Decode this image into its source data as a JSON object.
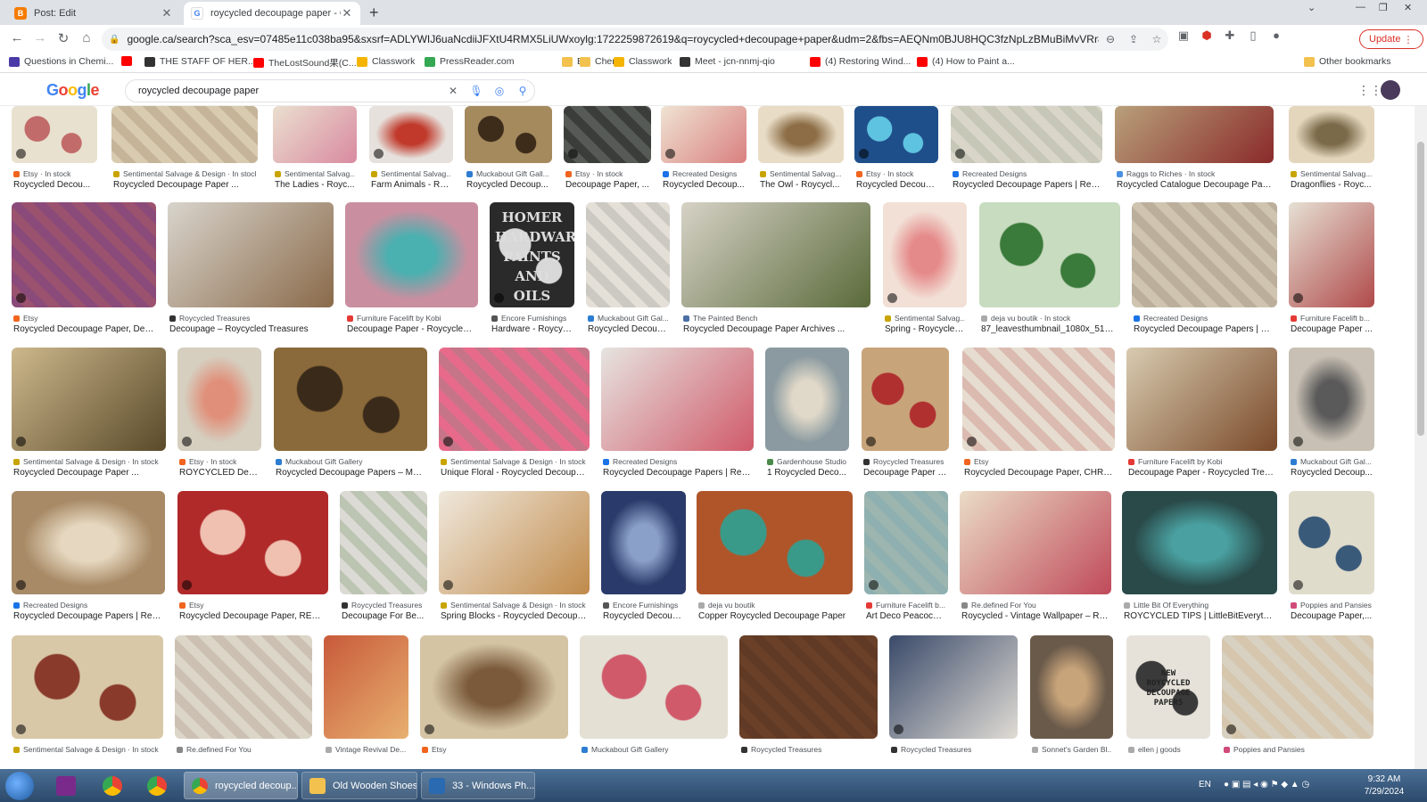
{
  "browser": {
    "tabs": [
      {
        "title": "Post: Edit",
        "favicon": "blogger-icon",
        "color": "#f57c00",
        "active": false
      },
      {
        "title": "roycycled decoupage paper - Go",
        "favicon": "google-icon",
        "color": "#4285f4",
        "active": true
      }
    ],
    "new_tab": "+",
    "url": "google.ca/search?sca_esv=07485e11c038ba95&sxsrf=ADLYWIJ6uaNcdiiJFXtU4RMX5LiUWxoylg:1722259872619&q=roycycled+decoupage+paper&udm=2&fbs=AEQNm0BJU8HQC3fzNpLzBMuBiMvVRr8BSz33Xp3ghdPGS7x...",
    "update_label": "Update",
    "bookmarks": [
      {
        "label": "Questions in Chemi...",
        "color": "#4a3aa8"
      },
      {
        "label": "",
        "color": "#ff0000"
      },
      {
        "label": "THE STAFF OF HER...",
        "color": "#333333"
      },
      {
        "label": "TheLostSound果(C...",
        "color": "#ff0000"
      },
      {
        "label": "Classwork",
        "color": "#f4b400"
      },
      {
        "label": "PressReader.com",
        "color": "#34a853"
      },
      {
        "label": "Bio",
        "color": "#f2c14e"
      },
      {
        "label": "Chem",
        "color": "#f2c14e"
      },
      {
        "label": "Classwork",
        "color": "#f4b400"
      },
      {
        "label": "Meet - jcn-nnmj-qio",
        "color": "#333333"
      },
      {
        "label": "(4) Restoring Wind...",
        "color": "#ff0000"
      },
      {
        "label": "(4) How to Paint a...",
        "color": "#ff0000"
      },
      {
        "label": "Other bookmarks",
        "color": "#f2c14e"
      }
    ]
  },
  "google": {
    "logo": "Google",
    "query": "roycycled decoupage paper"
  },
  "results": [
    [
      {
        "src": "Etsy · In stock",
        "title": "Roycycled Decou...",
        "bg": "#e9e1cf",
        "fg": "#c26b6b",
        "sc": "#f1641e"
      },
      {
        "src": "Sentimental Salvage & Design · In stock",
        "title": "Roycycled Decoupage Paper ...",
        "bg": "#d8cbb0",
        "fg": "#7a5a3a",
        "sc": "#c8a400"
      },
      {
        "src": "Sentimental Salvag...",
        "title": "The Ladies - Royc...",
        "bg": "#eadfcf",
        "fg": "#d98aa0",
        "sc": "#c8a400"
      },
      {
        "src": "Sentimental Salvag...",
        "title": "Farm Animals - Ro...",
        "bg": "#e6e1dc",
        "fg": "#c0392b",
        "sc": "#c8a400"
      },
      {
        "src": "Muckabout Gift Gall...",
        "title": "Roycycled Decoup...",
        "bg": "#a58a5e",
        "fg": "#3d2c1a",
        "sc": "#2d7dd2"
      },
      {
        "src": "Etsy · In stock",
        "title": "Decoupage Paper, ...",
        "bg": "#3a3d3a",
        "fg": "#c9d1c8",
        "sc": "#f1641e"
      },
      {
        "src": "Recreated Designs",
        "title": "Roycycled Decoup...",
        "bg": "#efe3d2",
        "fg": "#d98080",
        "sc": "#1a73e8"
      },
      {
        "src": "Sentimental Salvag...",
        "title": "The Owl - Roycycl...",
        "bg": "#e8dcc6",
        "fg": "#8c6d46",
        "sc": "#c8a400"
      },
      {
        "src": "Etsy · In stock",
        "title": "Roycycled Decoup...",
        "bg": "#1f4f8a",
        "fg": "#5ec3e0",
        "sc": "#f1641e"
      },
      {
        "src": "Recreated Designs",
        "title": "Roycycled Decoupage Papers | Recr...",
        "bg": "#d9d6c9",
        "fg": "#7a8a6e",
        "sc": "#1a73e8"
      },
      {
        "src": "Raggs to Riches · In stock",
        "title": "Roycycled Catalogue Decoupage Paper...",
        "bg": "#b8a07a",
        "fg": "#8a2a2a",
        "sc": "#4a90e2"
      },
      {
        "src": "Sentimental Salvag...",
        "title": "Dragonflies - Royc...",
        "bg": "#e3d6bc",
        "fg": "#7a6a4a",
        "sc": "#c8a400"
      }
    ],
    [
      {
        "src": "Etsy",
        "title": "Roycycled Decoupage Paper, Dec...",
        "bg": "#8a4a7a",
        "fg": "#e07040",
        "sc": "#f1641e"
      },
      {
        "src": "Roycycled Treasures",
        "title": "Decoupage – Roycycled Treasures",
        "bg": "#d8d4cc",
        "fg": "#8a6a4a",
        "sc": "#333333"
      },
      {
        "src": "Furniture Facelift by Kobi",
        "title": "Decoupage Paper - Roycycled ...",
        "bg": "#c98fa0",
        "fg": "#4ab0b0",
        "sc": "#e53935"
      },
      {
        "src": "Encore Furnishings",
        "title": "Hardware - Roycyc...",
        "bg": "#2a2a2a",
        "fg": "#d8d8d8",
        "sc": "#555555"
      },
      {
        "src": "Muckabout Gift Gal...",
        "title": "Roycycled Decoup...",
        "bg": "#e4e0d8",
        "fg": "#6a6a6a",
        "sc": "#2d7dd2"
      },
      {
        "src": "The Painted Bench",
        "title": "Roycycled Decoupage Paper Archives ...",
        "bg": "#d6d2c6",
        "fg": "#5a6a3a",
        "sc": "#4a6fa5"
      },
      {
        "src": "Sentimental Salvag...",
        "title": "Spring - Roycycled...",
        "bg": "#f2e0d6",
        "fg": "#e58a8a",
        "sc": "#c8a400"
      },
      {
        "src": "deja vu boutik · In stock",
        "title": "87_leavesthumbnail_1080x_516d...",
        "bg": "#c8dcc0",
        "fg": "#3a7a3a",
        "sc": "#aaaaaa"
      },
      {
        "src": "Recreated Designs",
        "title": "Roycycled Decoupage Papers | Re...",
        "bg": "#cfc4b0",
        "fg": "#6a5a4a",
        "sc": "#1a73e8"
      },
      {
        "src": "Furniture Facelift b...",
        "title": "Decoupage Paper ...",
        "bg": "#e6e0d4",
        "fg": "#b04a4a",
        "sc": "#e53935"
      }
    ],
    [
      {
        "src": "Sentimental Salvage & Design · In stock",
        "title": "Roycycled Decoupage Paper ...",
        "bg": "#cdb88c",
        "fg": "#5a4a2a",
        "sc": "#c8a400"
      },
      {
        "src": "Etsy · In stock",
        "title": "ROYCYCLED Dec...",
        "bg": "#d6cfc0",
        "fg": "#e0907a",
        "sc": "#f1641e"
      },
      {
        "src": "Muckabout Gift Gallery",
        "title": "Roycycled Decoupage Papers – Muc...",
        "bg": "#8a6a3a",
        "fg": "#3a2a1a",
        "sc": "#2d7dd2"
      },
      {
        "src": "Sentimental Salvage & Design · In stock",
        "title": "Unique Floral - Roycycled Decoupag...",
        "bg": "#e86a8a",
        "fg": "#3aa07a",
        "sc": "#c8a400"
      },
      {
        "src": "Recreated Designs",
        "title": "Roycycled Decoupage Papers | Recr...",
        "bg": "#e6e4e0",
        "fg": "#d05a6a",
        "sc": "#1a73e8"
      },
      {
        "src": "Gardenhouse Studio",
        "title": "1 Roycycled Deco...",
        "bg": "#8a9aa0",
        "fg": "#e0d8c8",
        "sc": "#4a8a4a"
      },
      {
        "src": "Roycycled Treasures",
        "title": "Decoupage Paper –...",
        "bg": "#c8a47a",
        "fg": "#b03030",
        "sc": "#333333"
      },
      {
        "src": "Etsy",
        "title": "Roycycled Decoupage Paper, CHRIS...",
        "bg": "#e6ddd0",
        "fg": "#b03030",
        "sc": "#f1641e"
      },
      {
        "src": "Furniture Facelift by Kobi",
        "title": "Decoupage Paper - Roycycled Treas...",
        "bg": "#d8cbb0",
        "fg": "#7a4a2a",
        "sc": "#e53935"
      },
      {
        "src": "Muckabout Gift Gal...",
        "title": "Roycycled Decoup...",
        "bg": "#c8c0b4",
        "fg": "#5a5a5a",
        "sc": "#2d7dd2"
      }
    ],
    [
      {
        "src": "Recreated Designs",
        "title": "Roycycled Decoupage Papers | Recr...",
        "bg": "#a88a66",
        "fg": "#e6d8c0",
        "sc": "#1a73e8"
      },
      {
        "src": "Etsy",
        "title": "Roycycled Decoupage Paper, RED ...",
        "bg": "#b02a2a",
        "fg": "#f0c0b0",
        "sc": "#f1641e"
      },
      {
        "src": "Roycycled Treasures",
        "title": "Decoupage For Be...",
        "bg": "#dcdad4",
        "fg": "#3a6a2a",
        "sc": "#333333"
      },
      {
        "src": "Sentimental Salvage & Design · In stock",
        "title": "Spring Blocks - Roycycled Decoupa...",
        "bg": "#efe8dc",
        "fg": "#c08a4a",
        "sc": "#c8a400"
      },
      {
        "src": "Encore Furnishings",
        "title": "Roycycled Decoup...",
        "bg": "#2a3a6a",
        "fg": "#8aa0c8",
        "sc": "#555555"
      },
      {
        "src": "deja vu boutik",
        "title": "Copper Roycycled Decoupage Paper",
        "bg": "#b0552a",
        "fg": "#3a9a8a",
        "sc": "#aaaaaa"
      },
      {
        "src": "Furniture Facelift b...",
        "title": "Art Deco Peacock ...",
        "bg": "#8fb0b0",
        "fg": "#d0c8a8",
        "sc": "#e53935"
      },
      {
        "src": "Re.defined For You",
        "title": "Roycycled - Vintage Wallpaper – Re ...",
        "bg": "#eadcc6",
        "fg": "#c04a5a",
        "sc": "#888888"
      },
      {
        "src": "Little Bit Of Everything",
        "title": "ROYCYCLED TIPS | LittleBitEverything",
        "bg": "#2a4a4a",
        "fg": "#4aa0a0",
        "sc": "#aaaaaa"
      },
      {
        "src": "Poppies and Pansies",
        "title": "Decoupage Paper,...",
        "bg": "#e0dccc",
        "fg": "#3a5a7a",
        "sc": "#d04a7a"
      }
    ],
    [
      {
        "src": "Sentimental Salvage & Design · In stock",
        "title": "",
        "bg": "#d8c8a8",
        "fg": "#8a3a2a",
        "sc": "#c8a400"
      },
      {
        "src": "Re.defined For You",
        "title": "",
        "bg": "#dcd6c8",
        "fg": "#8a6a5a",
        "sc": "#888888"
      },
      {
        "src": "Vintage Revival De...",
        "title": "",
        "bg": "#c85a3a",
        "fg": "#e8b070",
        "sc": "#aaaaaa"
      },
      {
        "src": "Etsy",
        "title": "",
        "bg": "#d4c4a4",
        "fg": "#7a5a3a",
        "sc": "#f1641e"
      },
      {
        "src": "Muckabout Gift Gallery",
        "title": "",
        "bg": "#e4e0d4",
        "fg": "#d05a6a",
        "sc": "#2d7dd2"
      },
      {
        "src": "Roycycled Treasures",
        "title": "",
        "bg": "#6a4028",
        "fg": "#3a2418",
        "sc": "#333333"
      },
      {
        "src": "Roycycled Treasures",
        "title": "",
        "bg": "#3a4a6a",
        "fg": "#e0dcd4",
        "sc": "#333333"
      },
      {
        "src": "Sonnet's Garden Bl...",
        "title": "",
        "bg": "#6a5a4a",
        "fg": "#c8a47a",
        "sc": "#aaaaaa"
      },
      {
        "src": "ellen j goods",
        "title": "",
        "bg": "#e6e2da",
        "fg": "#3a3a3a",
        "sc": "#aaaaaa"
      },
      {
        "src": "Poppies and Pansies",
        "title": "",
        "bg": "#d8d0c0",
        "fg": "#c8a060",
        "sc": "#d04a7a"
      }
    ]
  ],
  "hardware_sign": "HOMER HARDWARE PAINTS AND OILS GARDEN SEEDS",
  "roycycled_sign": "NEW ROYCYCLED DECOUPAGE PAPERS",
  "taskbar": {
    "windows": [
      {
        "label": "roycycled decoup...",
        "color": "#4285f4",
        "active": true
      },
      {
        "label": "Old Wooden Shoes",
        "color": "#f2c14e",
        "active": false
      },
      {
        "label": "33 - Windows Ph...",
        "color": "#2a6ab0",
        "active": false
      }
    ],
    "lang": "EN",
    "time": "9:32 AM",
    "date": "7/29/2024"
  }
}
